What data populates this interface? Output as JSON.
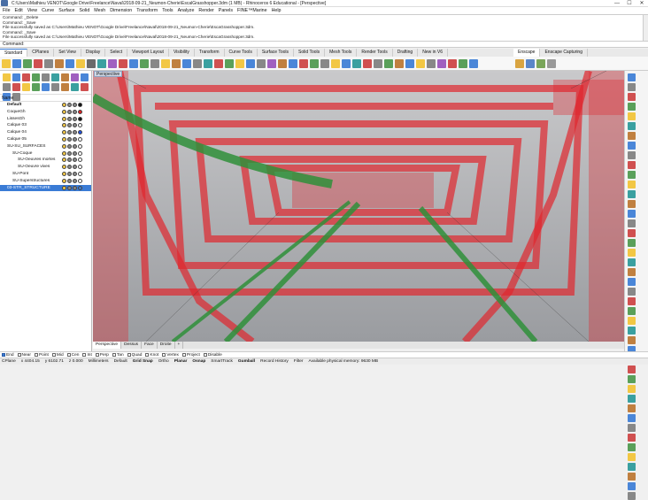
{
  "window": {
    "title": "C:\\Users\\Mathieu VENOT\\Google Drive\\Freelance\\Naval\\2018-09-21_Neumon-Cherie\\EscalGrasshopper.3dm (1 MB) - Rhinoceros 6 Educational - [Perspective]",
    "minimize": "—",
    "maximize": "☐",
    "close": "✕"
  },
  "menu": [
    "File",
    "Edit",
    "View",
    "Curve",
    "Surface",
    "Solid",
    "Mesh",
    "Dimension",
    "Transform",
    "Tools",
    "Analyze",
    "Render",
    "Panels",
    "FINE™Marine",
    "Help"
  ],
  "command_history": [
    "Command: _Delete",
    "Command: _Save",
    "File successfully saved as C:\\Users\\Mathieu VENOT\\Google Drive\\Freelance\\Naval\\2018-09-21_Neumon-Cherie\\EscaGrasshopper.3dm.",
    "Command: _Save",
    "File successfully saved as C:\\Users\\Mathieu VENOT\\Google Drive\\Freelance\\Naval\\2018-09-21_Neumon-Cherie\\EscaGrasshopper.3dm."
  ],
  "command_prompt": "Command:",
  "toolbar_tabs": [
    "Standard",
    "CPlanes",
    "Set View",
    "Display",
    "Select",
    "Viewport Layout",
    "Visibility",
    "Transform",
    "Curve Tools",
    "Surface Tools",
    "Solid Tools",
    "Mesh Tools",
    "Render Tools",
    "Drafting",
    "New in V6"
  ],
  "right_tabs": [
    "Enscape",
    "Enscape Capturing"
  ],
  "layers": {
    "header": "Name",
    "rows": [
      {
        "name": "Default",
        "indent": 0,
        "color": "#111111",
        "bold": true
      },
      {
        "name": "CoqueGh",
        "indent": 0,
        "color": "#e02020"
      },
      {
        "name": "LissesGh",
        "indent": 0,
        "color": "#111111"
      },
      {
        "name": "Calque 03",
        "indent": 0,
        "color": "#ffffff"
      },
      {
        "name": "Calque 04",
        "indent": 0,
        "color": "#2050e0"
      },
      {
        "name": "Calque 05",
        "indent": 0,
        "color": "#ffffff"
      },
      {
        "name": "SU-SU_SURFACES",
        "indent": 0,
        "color": "#ffffff"
      },
      {
        "name": "SU-Coque",
        "indent": 1,
        "color": "#ffffff"
      },
      {
        "name": "SU-Oeuvres mortes",
        "indent": 2,
        "color": "#ffffff"
      },
      {
        "name": "SU-Oeuvre vives",
        "indent": 2,
        "color": "#ffffff"
      },
      {
        "name": "SU-Pont",
        "indent": 1,
        "color": "#ffffff"
      },
      {
        "name": "SU-Superstructures",
        "indent": 1,
        "color": "#ffffff"
      },
      {
        "name": "03-STR_STRUCTURE",
        "indent": 0,
        "color": "#3a7bd5",
        "selected": true
      }
    ]
  },
  "viewport": {
    "label": "Perspective",
    "tabs": [
      "Perspective",
      "Dessus",
      "Face",
      "Droite",
      "+"
    ]
  },
  "osnaps": [
    {
      "label": "End",
      "on": true
    },
    {
      "label": "Near",
      "on": false
    },
    {
      "label": "Point",
      "on": false
    },
    {
      "label": "Mid",
      "on": false
    },
    {
      "label": "Cen",
      "on": false
    },
    {
      "label": "Int",
      "on": false
    },
    {
      "label": "Perp",
      "on": false
    },
    {
      "label": "Tan",
      "on": false
    },
    {
      "label": "Quad",
      "on": false
    },
    {
      "label": "Knot",
      "on": false
    },
    {
      "label": "Vertex",
      "on": false
    },
    {
      "label": "Project",
      "on": false
    },
    {
      "label": "Disable",
      "on": false
    }
  ],
  "status": {
    "cplane": "CPlane",
    "x": "x 4404.15",
    "y": "y 6102.71",
    "z": "z 0.000",
    "units": "Millimeters",
    "layer": "Default",
    "grid_snap": "Grid Snap",
    "ortho": "Ortho",
    "planar": "Planar",
    "osnap": "Osnap",
    "smarttrack": "SmartTrack",
    "gumball": "Gumball",
    "record_history": "Record History",
    "filter": "Filter",
    "memory": "Available physical memory: 9630 MB"
  },
  "colors": {
    "accent": "#3a7bd5",
    "structure_red": "#e0262e",
    "pipe_green": "#2f8f3a",
    "viewport_bg": "#aeb0b4"
  }
}
